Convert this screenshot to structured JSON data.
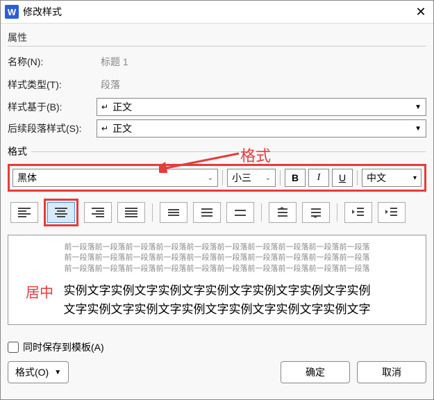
{
  "titlebar": {
    "icon_letter": "W",
    "title": "修改样式",
    "close_glyph": "✕"
  },
  "sections": {
    "properties": "属性",
    "format": "格式"
  },
  "properties": {
    "name_label": "名称(N):",
    "name_value": "标题 1",
    "type_label": "样式类型(T):",
    "type_value": "段落",
    "based_label": "样式基于(B):",
    "based_value": "正文",
    "based_arrow": "↵",
    "next_label": "后续段落样式(S):",
    "next_value": "正文",
    "next_arrow": "↵",
    "dropdown_glyph": "▼"
  },
  "format_toolbar": {
    "font_name": "黑体",
    "font_size": "小三",
    "bold": "B",
    "italic": "I",
    "underline": "U",
    "lang": "中文",
    "dropdown_glyph": "⌄",
    "dd2": "▾"
  },
  "annotations": {
    "format": "格式",
    "center": "居中"
  },
  "preview": {
    "gray1": "前一段落前一段落前一段落前一段落前一段落前一段落前一段落前一段落前一段落前一段落",
    "gray2": "前一段落前一段落前一段落前一段落前一段落前一段落前一段落前一段落前一段落前一段落",
    "gray3": "前一段落前一段落前一段落前一段落前一段落前一段落前一段落前一段落前一段落前一段落",
    "sample1": "实例文字实例文字实例文字实例文字实例文字实例文字实例",
    "sample2": "文字实例文字实例文字实例文字实例文字实例文字实例文字"
  },
  "save_template": {
    "label": "同时保存到模板(A)"
  },
  "buttons": {
    "format": "格式(O)",
    "ok": "确定",
    "cancel": "取消",
    "dd": "▼"
  }
}
